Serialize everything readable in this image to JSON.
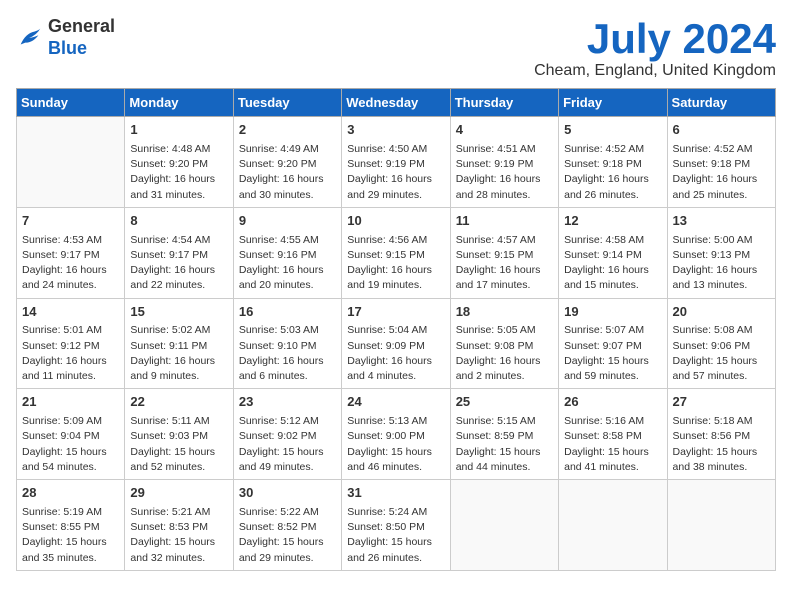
{
  "header": {
    "title": "July 2024",
    "location": "Cheam, England, United Kingdom",
    "logo_general": "General",
    "logo_blue": "Blue"
  },
  "days_of_week": [
    "Sunday",
    "Monday",
    "Tuesday",
    "Wednesday",
    "Thursday",
    "Friday",
    "Saturday"
  ],
  "weeks": [
    [
      {
        "day": null
      },
      {
        "day": 1,
        "sunrise": "4:48 AM",
        "sunset": "9:20 PM",
        "daylight": "16 hours and 31 minutes."
      },
      {
        "day": 2,
        "sunrise": "4:49 AM",
        "sunset": "9:20 PM",
        "daylight": "16 hours and 30 minutes."
      },
      {
        "day": 3,
        "sunrise": "4:50 AM",
        "sunset": "9:19 PM",
        "daylight": "16 hours and 29 minutes."
      },
      {
        "day": 4,
        "sunrise": "4:51 AM",
        "sunset": "9:19 PM",
        "daylight": "16 hours and 28 minutes."
      },
      {
        "day": 5,
        "sunrise": "4:52 AM",
        "sunset": "9:18 PM",
        "daylight": "16 hours and 26 minutes."
      },
      {
        "day": 6,
        "sunrise": "4:52 AM",
        "sunset": "9:18 PM",
        "daylight": "16 hours and 25 minutes."
      }
    ],
    [
      {
        "day": 7,
        "sunrise": "4:53 AM",
        "sunset": "9:17 PM",
        "daylight": "16 hours and 24 minutes."
      },
      {
        "day": 8,
        "sunrise": "4:54 AM",
        "sunset": "9:17 PM",
        "daylight": "16 hours and 22 minutes."
      },
      {
        "day": 9,
        "sunrise": "4:55 AM",
        "sunset": "9:16 PM",
        "daylight": "16 hours and 20 minutes."
      },
      {
        "day": 10,
        "sunrise": "4:56 AM",
        "sunset": "9:15 PM",
        "daylight": "16 hours and 19 minutes."
      },
      {
        "day": 11,
        "sunrise": "4:57 AM",
        "sunset": "9:15 PM",
        "daylight": "16 hours and 17 minutes."
      },
      {
        "day": 12,
        "sunrise": "4:58 AM",
        "sunset": "9:14 PM",
        "daylight": "16 hours and 15 minutes."
      },
      {
        "day": 13,
        "sunrise": "5:00 AM",
        "sunset": "9:13 PM",
        "daylight": "16 hours and 13 minutes."
      }
    ],
    [
      {
        "day": 14,
        "sunrise": "5:01 AM",
        "sunset": "9:12 PM",
        "daylight": "16 hours and 11 minutes."
      },
      {
        "day": 15,
        "sunrise": "5:02 AM",
        "sunset": "9:11 PM",
        "daylight": "16 hours and 9 minutes."
      },
      {
        "day": 16,
        "sunrise": "5:03 AM",
        "sunset": "9:10 PM",
        "daylight": "16 hours and 6 minutes."
      },
      {
        "day": 17,
        "sunrise": "5:04 AM",
        "sunset": "9:09 PM",
        "daylight": "16 hours and 4 minutes."
      },
      {
        "day": 18,
        "sunrise": "5:05 AM",
        "sunset": "9:08 PM",
        "daylight": "16 hours and 2 minutes."
      },
      {
        "day": 19,
        "sunrise": "5:07 AM",
        "sunset": "9:07 PM",
        "daylight": "15 hours and 59 minutes."
      },
      {
        "day": 20,
        "sunrise": "5:08 AM",
        "sunset": "9:06 PM",
        "daylight": "15 hours and 57 minutes."
      }
    ],
    [
      {
        "day": 21,
        "sunrise": "5:09 AM",
        "sunset": "9:04 PM",
        "daylight": "15 hours and 54 minutes."
      },
      {
        "day": 22,
        "sunrise": "5:11 AM",
        "sunset": "9:03 PM",
        "daylight": "15 hours and 52 minutes."
      },
      {
        "day": 23,
        "sunrise": "5:12 AM",
        "sunset": "9:02 PM",
        "daylight": "15 hours and 49 minutes."
      },
      {
        "day": 24,
        "sunrise": "5:13 AM",
        "sunset": "9:00 PM",
        "daylight": "15 hours and 46 minutes."
      },
      {
        "day": 25,
        "sunrise": "5:15 AM",
        "sunset": "8:59 PM",
        "daylight": "15 hours and 44 minutes."
      },
      {
        "day": 26,
        "sunrise": "5:16 AM",
        "sunset": "8:58 PM",
        "daylight": "15 hours and 41 minutes."
      },
      {
        "day": 27,
        "sunrise": "5:18 AM",
        "sunset": "8:56 PM",
        "daylight": "15 hours and 38 minutes."
      }
    ],
    [
      {
        "day": 28,
        "sunrise": "5:19 AM",
        "sunset": "8:55 PM",
        "daylight": "15 hours and 35 minutes."
      },
      {
        "day": 29,
        "sunrise": "5:21 AM",
        "sunset": "8:53 PM",
        "daylight": "15 hours and 32 minutes."
      },
      {
        "day": 30,
        "sunrise": "5:22 AM",
        "sunset": "8:52 PM",
        "daylight": "15 hours and 29 minutes."
      },
      {
        "day": 31,
        "sunrise": "5:24 AM",
        "sunset": "8:50 PM",
        "daylight": "15 hours and 26 minutes."
      },
      {
        "day": null
      },
      {
        "day": null
      },
      {
        "day": null
      }
    ]
  ]
}
